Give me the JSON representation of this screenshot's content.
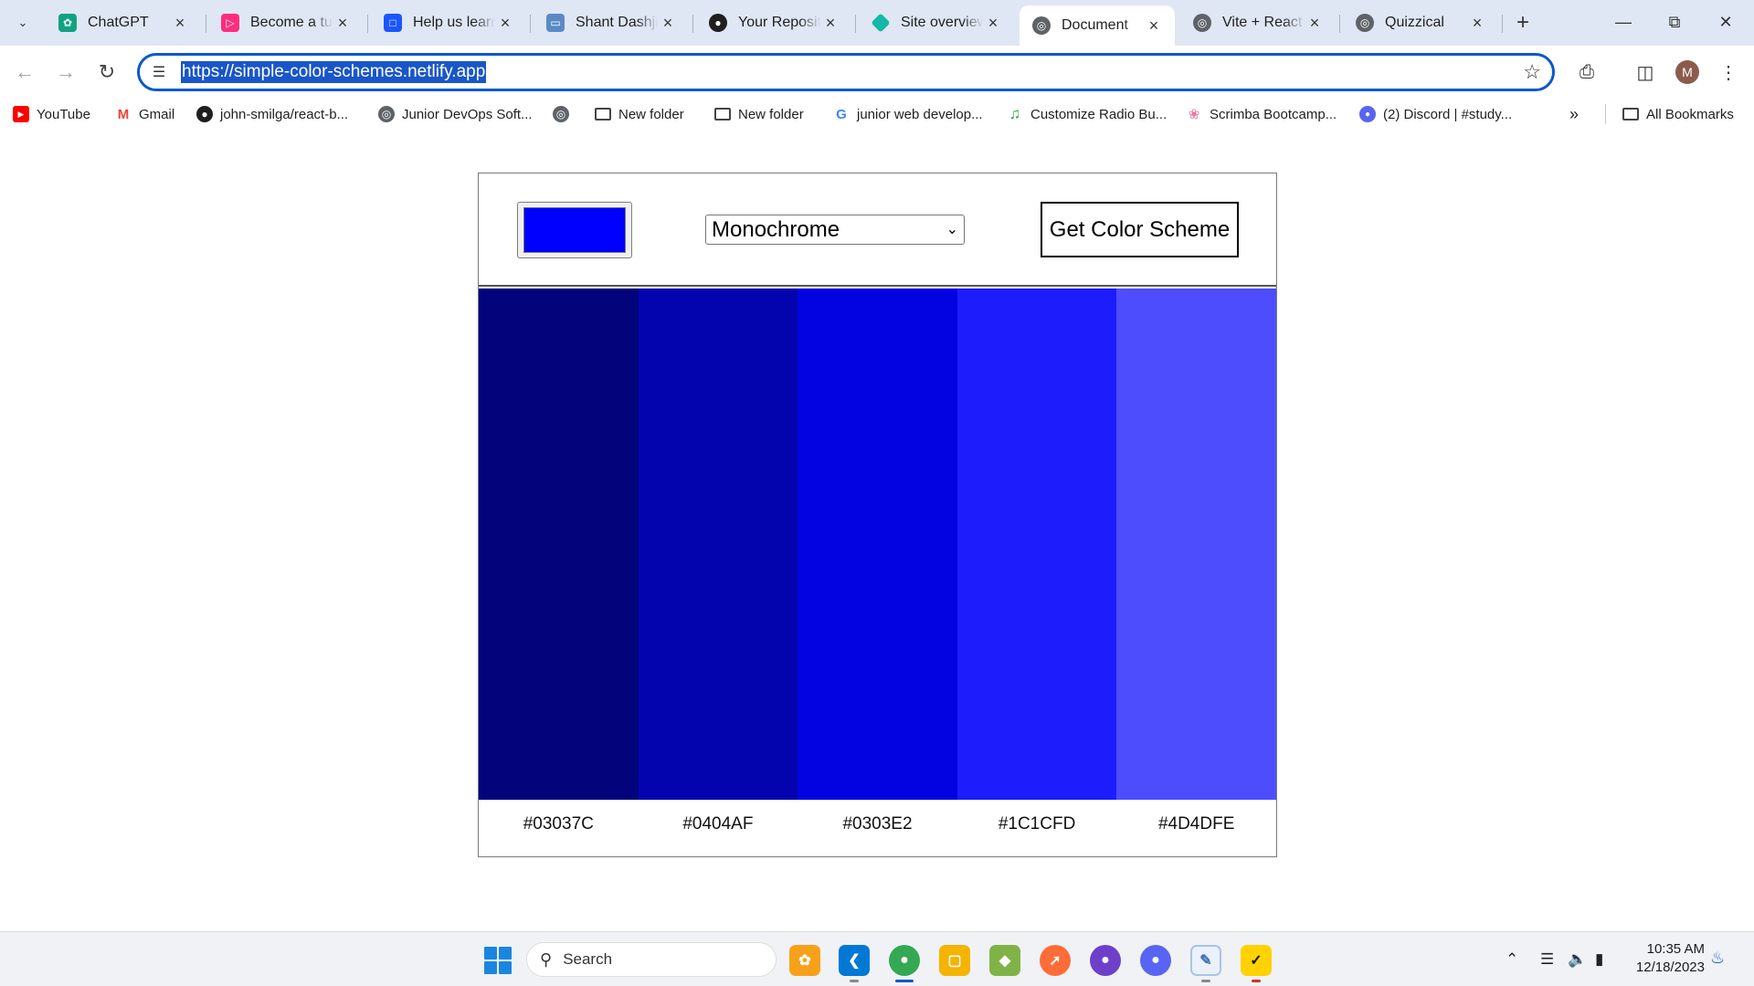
{
  "browser": {
    "tabs": [
      {
        "title": "ChatGPT",
        "icon": "chatgpt-icon",
        "color": "#10a37f",
        "active": false
      },
      {
        "title": "Become a tutor",
        "icon": "preply-icon",
        "color": "#ff2d7e",
        "active": false
      },
      {
        "title": "Help us learn",
        "icon": "form-icon",
        "color": "#1a56ff",
        "active": false
      },
      {
        "title": "Shant Dashjian",
        "icon": "monitor-icon",
        "color": "#5a8ac6",
        "active": false
      },
      {
        "title": "Your Repositories",
        "icon": "github-icon",
        "color": "#1f1f1f",
        "active": false
      },
      {
        "title": "Site overview",
        "icon": "netlify-icon",
        "color": "#14b8a6",
        "active": false
      },
      {
        "title": "Document",
        "icon": "globe-icon",
        "color": "#5f6368",
        "active": true
      },
      {
        "title": "Vite + React",
        "icon": "globe-icon",
        "color": "#5f6368",
        "active": false
      },
      {
        "title": "Quizzical",
        "icon": "globe-icon",
        "color": "#5f6368",
        "active": false
      }
    ],
    "url": "https://simple-color-schemes.netlify.app",
    "profile_initial": "M",
    "bookmarks": [
      {
        "label": "YouTube",
        "icon": "youtube-icon"
      },
      {
        "label": "Gmail",
        "icon": "gmail-icon"
      },
      {
        "label": "john-smilga/react-b...",
        "icon": "github-icon"
      },
      {
        "label": "Junior DevOps Soft...",
        "icon": "globe-icon"
      },
      {
        "label": "",
        "icon": "globe-icon"
      },
      {
        "label": "New folder",
        "icon": "folder-icon"
      },
      {
        "label": "New folder",
        "icon": "folder-icon"
      },
      {
        "label": "junior web develop...",
        "icon": "google-icon"
      },
      {
        "label": "Customize Radio Bu...",
        "icon": "music-icon"
      },
      {
        "label": "Scrimba Bootcamp...",
        "icon": "scrimba-icon"
      },
      {
        "label": "(2) Discord | #study...",
        "icon": "discord-icon"
      }
    ],
    "all_bookmarks_label": "All Bookmarks"
  },
  "app": {
    "seed_color": "#0000ff",
    "mode": "Monochrome",
    "get_button_label": "Get Color Scheme",
    "colors": [
      "#03037C",
      "#0404AF",
      "#0303E2",
      "#1C1CFD",
      "#4D4DFE"
    ]
  },
  "taskbar": {
    "search_label": "Search",
    "apps": [
      {
        "name": "copilot-icon",
        "color": "#f7a11a"
      },
      {
        "name": "vscode-icon",
        "color": "#0078d4"
      },
      {
        "name": "chrome-icon",
        "color": "#34a853"
      },
      {
        "name": "file-explorer-icon",
        "color": "#f4b400"
      },
      {
        "name": "git-icon",
        "color": "#7fb347"
      },
      {
        "name": "postman-icon",
        "color": "#ff6c37"
      },
      {
        "name": "github-desktop-icon",
        "color": "#6e40c9"
      },
      {
        "name": "discord-icon",
        "color": "#5865f2"
      },
      {
        "name": "notepad-icon",
        "color": "#a7c4e8"
      },
      {
        "name": "norton-icon",
        "color": "#ffd200"
      }
    ],
    "time": "10:35 AM",
    "date": "12/18/2023"
  }
}
